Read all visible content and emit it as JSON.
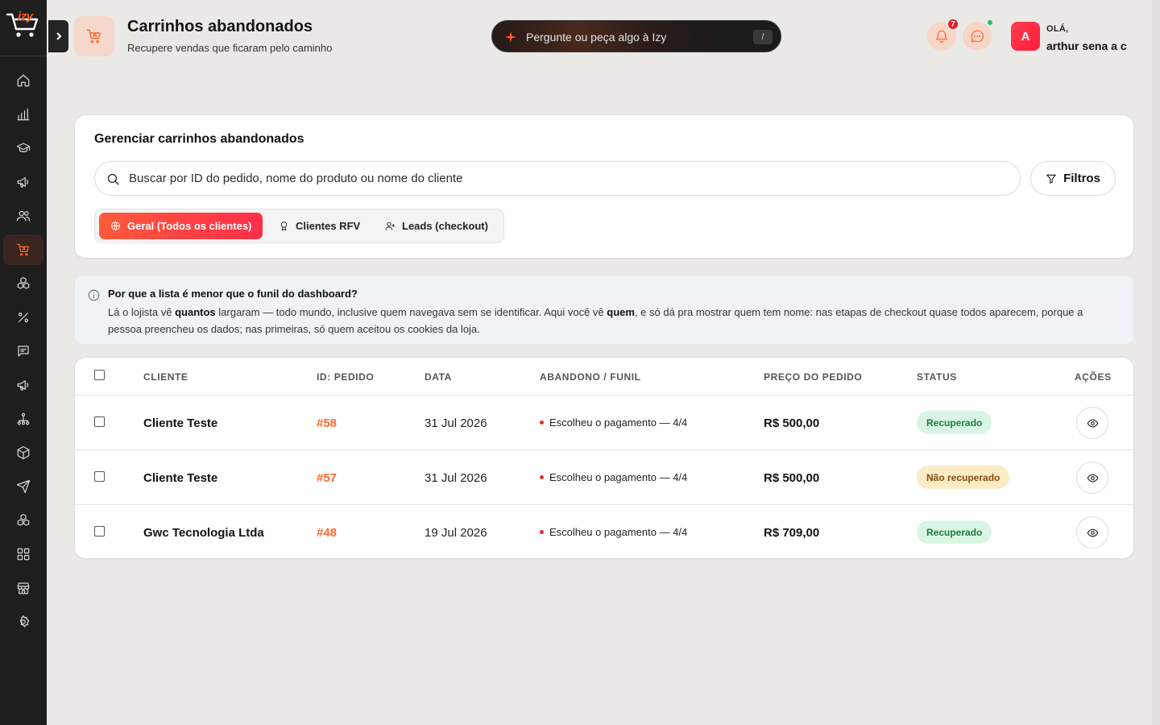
{
  "brand": {
    "logo_text": "izy"
  },
  "header": {
    "title": "Carrinhos abandonados",
    "subtitle": "Recupere vendas que ficaram pelo caminho",
    "ai_prompt": "Pergunte ou peça algo à Izy",
    "ai_shortcut": "/",
    "notifications_count": "7",
    "greeting": "OLÁ,",
    "user_name": "arthur sena a c",
    "avatar_initial": "A"
  },
  "sidebar": {
    "items": [
      {
        "name": "home-icon",
        "active": false
      },
      {
        "name": "bar-chart-icon",
        "active": false
      },
      {
        "name": "graduation-cap-icon",
        "active": false
      },
      {
        "name": "megaphone-icon",
        "active": false
      },
      {
        "name": "users-icon",
        "active": false
      },
      {
        "name": "cart-icon",
        "active": true
      },
      {
        "name": "boxes-icon",
        "active": false
      },
      {
        "name": "percent-icon",
        "active": false
      },
      {
        "name": "message-icon",
        "active": false
      },
      {
        "name": "megaphone-icon",
        "active": false
      },
      {
        "name": "network-icon",
        "active": false
      },
      {
        "name": "package-icon",
        "active": false
      },
      {
        "name": "send-icon",
        "active": false
      },
      {
        "name": "boxes-icon",
        "active": false
      },
      {
        "name": "grid-icon",
        "active": false
      },
      {
        "name": "store-icon",
        "active": false
      },
      {
        "name": "gear-icon",
        "active": false
      }
    ]
  },
  "filters": {
    "title": "Gerenciar carrinhos abandonados",
    "search_placeholder": "Buscar por ID do pedido, nome do produto ou nome do cliente",
    "filters_label": "Filtros",
    "tabs": [
      {
        "label": "Geral (Todos os clientes)",
        "icon": "globe-icon",
        "active": true
      },
      {
        "label": "Clientes RFV",
        "icon": "award-icon",
        "active": false
      },
      {
        "label": "Leads (checkout)",
        "icon": "user-plus-icon",
        "active": false
      }
    ]
  },
  "info": {
    "title": "Por que a lista é menor que o funil do dashboard?",
    "p1": "Lá o lojista vê ",
    "b1": "quantos",
    "p2": " largaram — todo mundo, inclusive quem navegava sem se identificar. Aqui você vê ",
    "b2": "quem",
    "p3": ", e só dá pra mostrar quem tem nome: nas etapas de checkout quase todos aparecem, porque a pessoa preencheu os dados; nas primeiras, só quem aceitou os cookies da loja."
  },
  "table": {
    "columns": {
      "client": "CLIENTE",
      "order": "ID: PEDIDO",
      "date": "DATA",
      "funnel": "ABANDONO / FUNIL",
      "price": "PREÇO DO PEDIDO",
      "status": "STATUS",
      "actions": "AÇÕES"
    },
    "rows": [
      {
        "client": "Cliente Teste",
        "order": "#58",
        "date": "31 Jul 2026",
        "funnel": "Escolheu o pagamento — 4/4",
        "price": "R$ 500,00",
        "status": "Recuperado",
        "status_type": "ok"
      },
      {
        "client": "Cliente Teste",
        "order": "#57",
        "date": "31 Jul 2026",
        "funnel": "Escolheu o pagamento — 4/4",
        "price": "R$ 500,00",
        "status": "Não recuperado",
        "status_type": "no"
      },
      {
        "client": "Gwc Tecnologia Ltda",
        "order": "#48",
        "date": "19 Jul 2026",
        "funnel": "Escolheu o pagamento — 4/4",
        "price": "R$ 709,00",
        "status": "Recuperado",
        "status_type": "ok"
      }
    ]
  },
  "colors": {
    "accent": "#ff6a2c",
    "sidebar_bg": "#1e1e1e",
    "status_ok_bg": "#d9f5e3",
    "status_no_bg": "#fbecc6"
  }
}
